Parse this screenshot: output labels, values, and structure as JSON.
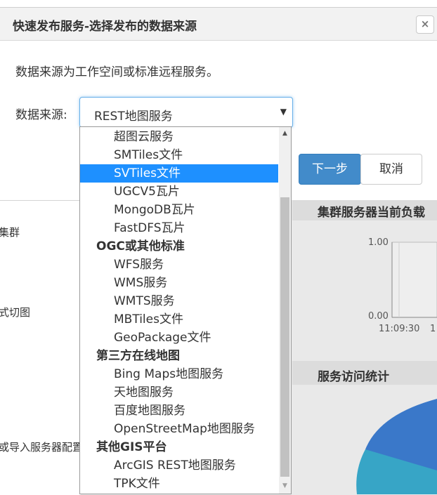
{
  "dialog": {
    "title": "快速发布服务-选择发布的数据来源",
    "close_icon": "×",
    "description": "数据来源为工作空间或标准远程服务。",
    "source_label": "数据来源:",
    "selected_value": "REST地图服务",
    "next_button": "下一步",
    "cancel_button": "取消"
  },
  "dropdown": {
    "options": [
      {
        "label": "超图云服务",
        "type": "item"
      },
      {
        "label": "SMTiles文件",
        "type": "item"
      },
      {
        "label": "SVTiles文件",
        "type": "item",
        "highlighted": true
      },
      {
        "label": "UGCV5瓦片",
        "type": "item"
      },
      {
        "label": "MongoDB瓦片",
        "type": "item"
      },
      {
        "label": "FastDFS瓦片",
        "type": "item"
      },
      {
        "label": "OGC或其他标准",
        "type": "group"
      },
      {
        "label": "WFS服务",
        "type": "item"
      },
      {
        "label": "WMS服务",
        "type": "item"
      },
      {
        "label": "WMTS服务",
        "type": "item"
      },
      {
        "label": "MBTiles文件",
        "type": "item"
      },
      {
        "label": "GeoPackage文件",
        "type": "item"
      },
      {
        "label": "第三方在线地图",
        "type": "group"
      },
      {
        "label": "Bing Maps地图服务",
        "type": "item"
      },
      {
        "label": "天地图服务",
        "type": "item"
      },
      {
        "label": "百度地图服务",
        "type": "item"
      },
      {
        "label": "OpenStreetMap地图服务",
        "type": "item"
      },
      {
        "label": "其他GIS平台",
        "type": "group"
      },
      {
        "label": "ArcGIS REST地图服务",
        "type": "item"
      },
      {
        "label": "TPK文件",
        "type": "item"
      }
    ]
  },
  "background": {
    "left_items": [
      "集群",
      "式切图",
      "或导入服务器配置"
    ],
    "cluster_load_title": "集群服务器当前负载",
    "service_stats_title": "服务访问统计",
    "y_top": "1.00",
    "y_bottom": "0.00",
    "x_tick_1": "11:09:30",
    "x_tick_2": "1"
  },
  "colors": {
    "accent": "#428bca",
    "highlight": "#1e90ff",
    "pie_blue": "#3a78c9",
    "pie_teal": "#37a5c6"
  }
}
